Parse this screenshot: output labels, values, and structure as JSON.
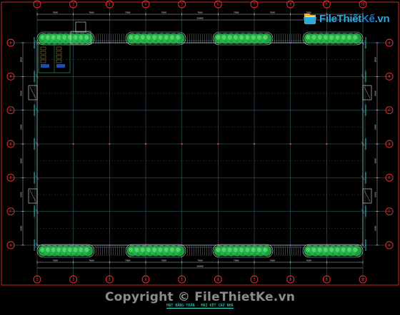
{
  "logo": {
    "brand": "FileThiết",
    "brand_suffix": "Kế",
    "domain": ".vn",
    "icon": "folder-book-icon",
    "color": "#2aa9e0"
  },
  "watermark": {
    "copyright": "Copyright © FileThietKe.vn"
  },
  "drawing": {
    "caption": "MẶT BẰNG TRẦN - MÁI KẾT CẤU NHÀ",
    "top_total_dim": "56000",
    "bottom_total_dim": "56000",
    "top_bay_dims": [
      "7000",
      "7000",
      "7000",
      "7000",
      "7000",
      "7000",
      "7000",
      "7000"
    ],
    "bottom_bay_dims": [
      "7000",
      "7000",
      "7000",
      "7000",
      "7000",
      "7000",
      "7000",
      "7000"
    ],
    "left_bay_dims": [
      "6000",
      "6000",
      "6000",
      "6000",
      "6000",
      "6000"
    ],
    "right_bay_dims": [
      "6000",
      "6000",
      "6000",
      "6000",
      "6000",
      "6000"
    ],
    "top_axes": [
      "1",
      "2",
      "3",
      "4",
      "5",
      "6",
      "7",
      "8",
      "9",
      "10"
    ],
    "bottom_axes": [
      "1",
      "2",
      "3",
      "4",
      "5",
      "6",
      "7",
      "8",
      "9",
      "10"
    ],
    "left_axes": [
      "A",
      "B",
      "C",
      "D",
      "E",
      "F",
      "G"
    ],
    "right_axes": [
      "A",
      "B",
      "C",
      "D",
      "E",
      "F",
      "G"
    ]
  },
  "colors": {
    "background": "#000000",
    "grid": "#3c6d78",
    "frame": "#ffffff",
    "border": "#ff3030",
    "bubble": "#ff3030",
    "foliage": "#22b84a",
    "cyan": "#37e0d2",
    "magenta": "#e040e0"
  }
}
